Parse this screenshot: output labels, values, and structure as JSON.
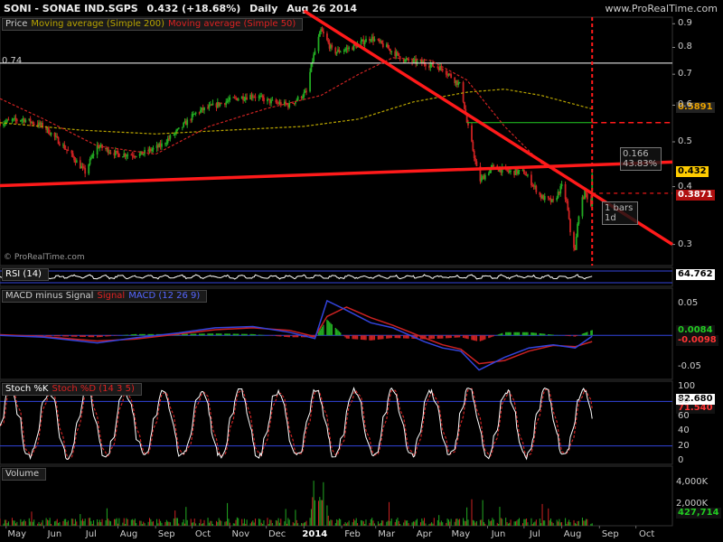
{
  "header": {
    "symbol": "SONI - SONAE IND.SGPS",
    "last": "0.432 (+18.68%)",
    "period": "Daily",
    "date": "Aug 26 2014",
    "brand": "www.ProRealTime.com"
  },
  "copyright": "© ProRealTime.com",
  "colors": {
    "up": "#22aa22",
    "down": "#cc2222",
    "ma200": "#b8a400",
    "ma50": "#cc2222",
    "trend": "#ff1a1a",
    "level_line": "#ffffff",
    "support_green": "#22cc22",
    "macd_line": "#3344dd",
    "signal_line": "#cc2222",
    "stoch_k": "#ffffff",
    "stoch_d": "#cc2222"
  },
  "price_panel": {
    "legend": [
      "Price",
      "Moving average (Simple 200)",
      "Moving average (Simple 50)"
    ],
    "level_label": "0.74",
    "annot_box": [
      "0.166",
      "43.83%"
    ],
    "bars_box": [
      "1 bars",
      "1d"
    ]
  },
  "rsi_panel": {
    "legend": [
      "RSI (14)"
    ]
  },
  "macd_panel": {
    "legend": [
      "MACD minus Signal",
      "Signal",
      "MACD (12 26 9)"
    ]
  },
  "stoch_panel": {
    "legend": [
      "Stoch %K",
      "Stoch %D (14 3 5)"
    ]
  },
  "volume_panel": {
    "legend": [
      "Volume"
    ]
  },
  "chart_data": [
    {
      "type": "candlestick",
      "title": "SONI - SONAE IND.SGPS",
      "x_labels": [
        "May",
        "Jun",
        "Jul",
        "Aug",
        "Sep",
        "Oct",
        "Nov",
        "Dec",
        "2014",
        "Feb",
        "Mar",
        "Apr",
        "May",
        "Jun",
        "Jul",
        "Aug",
        "Sep",
        "Oct"
      ],
      "y_ticks": [
        "0.9",
        "0.8",
        "0.7",
        "0.6",
        "0.5",
        "0.4",
        "0.3"
      ],
      "y_scale": "log",
      "ylim": [
        0.27,
        0.93
      ],
      "close_path": {
        "dates": [
          "2013-04-26",
          "2013-05-15",
          "2013-06-01",
          "2013-06-20",
          "2013-07-05",
          "2013-07-15",
          "2013-08-01",
          "2013-08-20",
          "2013-09-05",
          "2013-09-20",
          "2013-10-05",
          "2013-10-20",
          "2013-11-05",
          "2013-11-20",
          "2013-12-05",
          "2013-12-20",
          "2014-01-03",
          "2014-01-08",
          "2014-01-15",
          "2014-01-25",
          "2014-02-10",
          "2014-02-25",
          "2014-03-10",
          "2014-03-25",
          "2014-04-10",
          "2014-04-25",
          "2014-05-10",
          "2014-05-15",
          "2014-05-25",
          "2014-06-05",
          "2014-06-20",
          "2014-07-01",
          "2014-07-15",
          "2014-07-25",
          "2014-08-01",
          "2014-08-05",
          "2014-08-08",
          "2014-08-12",
          "2014-08-15",
          "2014-08-20",
          "2014-08-25",
          "2014-08-26"
        ],
        "close": [
          0.55,
          0.56,
          0.54,
          0.48,
          0.43,
          0.49,
          0.47,
          0.47,
          0.49,
          0.53,
          0.58,
          0.6,
          0.62,
          0.63,
          0.61,
          0.6,
          0.64,
          0.75,
          0.87,
          0.78,
          0.8,
          0.84,
          0.8,
          0.75,
          0.74,
          0.72,
          0.66,
          0.55,
          0.41,
          0.44,
          0.43,
          0.43,
          0.38,
          0.37,
          0.4,
          0.37,
          0.32,
          0.29,
          0.35,
          0.39,
          0.364,
          0.432
        ]
      },
      "moving_average_200_path": {
        "dates": [
          "2013-04-26",
          "2013-07-01",
          "2013-09-01",
          "2013-11-01",
          "2014-01-01",
          "2014-02-15",
          "2014-04-01",
          "2014-05-15",
          "2014-06-15",
          "2014-07-15",
          "2014-08-26"
        ],
        "values": [
          0.55,
          0.53,
          0.52,
          0.53,
          0.54,
          0.56,
          0.61,
          0.64,
          0.65,
          0.63,
          0.589
        ]
      },
      "moving_average_50_path": {
        "dates": [
          "2013-04-26",
          "2013-06-01",
          "2013-07-15",
          "2013-09-01",
          "2013-10-15",
          "2013-12-01",
          "2014-01-15",
          "2014-02-15",
          "2014-03-15",
          "2014-04-15",
          "2014-05-15",
          "2014-06-15",
          "2014-07-15",
          "2014-08-26"
        ],
        "values": [
          0.62,
          0.56,
          0.49,
          0.47,
          0.54,
          0.59,
          0.63,
          0.7,
          0.76,
          0.75,
          0.68,
          0.54,
          0.45,
          0.387
        ]
      },
      "horizontal_level": 0.74,
      "support_level": 0.55,
      "annotations": {
        "change_box": [
          "0.166",
          "43.83%"
        ],
        "bars_box": [
          "1 bars",
          "1d"
        ],
        "marker_date": "2014-08-26"
      },
      "trendlines": [
        {
          "from": [
            "2013-04-26",
            0.402
          ],
          "to": [
            "2014-10-31",
            0.452
          ]
        },
        {
          "from": [
            "2014-01-01",
            0.96
          ],
          "to": [
            "2014-10-31",
            0.3
          ]
        }
      ],
      "last_labels": {
        "price": "0.432",
        "ma200": "0.5891",
        "ma50": "0.3871"
      }
    },
    {
      "type": "line",
      "title": "RSI (14)",
      "last": "64.762"
    },
    {
      "type": "histogram",
      "title": "MACD (12 26 9)",
      "y_ticks": [
        "0.05",
        "0",
        "-0.05"
      ],
      "ylim": [
        -0.07,
        0.075
      ],
      "last": {
        "macd_minus_signal": "0.0084",
        "signal": "-0.0098"
      },
      "macd_path": {
        "dates": [
          "2013-04-26",
          "2013-06-01",
          "2013-07-15",
          "2013-08-15",
          "2013-09-20",
          "2013-10-20",
          "2013-11-20",
          "2013-12-20",
          "2014-01-10",
          "2014-01-20",
          "2014-02-05",
          "2014-02-25",
          "2014-03-15",
          "2014-04-10",
          "2014-04-25",
          "2014-05-10",
          "2014-05-25",
          "2014-06-15",
          "2014-07-05",
          "2014-07-25",
          "2014-08-12",
          "2014-08-26"
        ],
        "values": [
          0.0,
          -0.003,
          -0.012,
          -0.004,
          0.004,
          0.012,
          0.014,
          0.005,
          -0.005,
          0.055,
          0.04,
          0.02,
          0.012,
          -0.01,
          -0.02,
          -0.025,
          -0.055,
          -0.035,
          -0.02,
          -0.015,
          -0.02,
          -0.0014
        ]
      },
      "signal_path": {
        "dates": [
          "2013-04-26",
          "2013-06-01",
          "2013-07-15",
          "2013-08-15",
          "2013-09-20",
          "2013-10-20",
          "2013-11-20",
          "2013-12-20",
          "2014-01-10",
          "2014-01-20",
          "2014-02-05",
          "2014-02-25",
          "2014-03-15",
          "2014-04-10",
          "2014-04-25",
          "2014-05-10",
          "2014-05-25",
          "2014-06-15",
          "2014-07-05",
          "2014-07-25",
          "2014-08-12",
          "2014-08-26"
        ],
        "values": [
          0.001,
          -0.002,
          -0.009,
          -0.006,
          0.002,
          0.009,
          0.012,
          0.008,
          -0.002,
          0.03,
          0.045,
          0.028,
          0.016,
          -0.004,
          -0.015,
          -0.022,
          -0.045,
          -0.04,
          -0.025,
          -0.016,
          -0.018,
          -0.0098
        ]
      }
    },
    {
      "type": "line",
      "title": "Stoch %K / Stoch %D (14 3 5)",
      "y_ticks": [
        "100",
        "80",
        "60",
        "40",
        "20",
        "0"
      ],
      "ylim": [
        0,
        100
      ],
      "overbought": 80,
      "oversold": 20,
      "last": {
        "k": "82.680",
        "d": "71.540"
      }
    },
    {
      "type": "bar",
      "title": "Volume",
      "y_ticks": [
        "4,000K",
        "2,000K"
      ],
      "last": "427,714"
    }
  ]
}
